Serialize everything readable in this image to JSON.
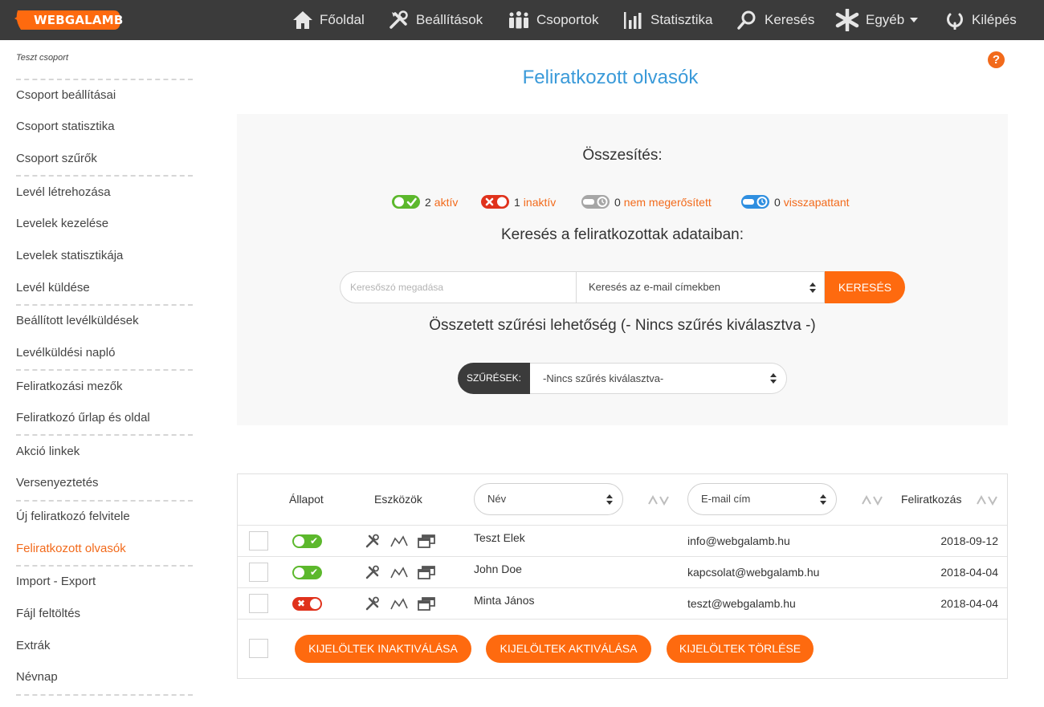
{
  "navbar": {
    "logo": "WEBGALAMB",
    "items": [
      {
        "label": "Főoldal",
        "icon": "home-icon"
      },
      {
        "label": "Beállítások",
        "icon": "tools-icon"
      },
      {
        "label": "Csoportok",
        "icon": "group-icon"
      },
      {
        "label": "Statisztika",
        "icon": "bar-chart-icon"
      },
      {
        "label": "Keresés",
        "icon": "search-icon"
      },
      {
        "label": "Egyéb",
        "icon": "asterisk-icon"
      },
      {
        "label": "Kilépés",
        "icon": "logout-icon"
      }
    ]
  },
  "sidebar": {
    "group": "Teszt csoport",
    "items": [
      "Csoport beállításai",
      "Csoport statisztika",
      "Csoport szűrők",
      "Levél létrehozása",
      "Levelek kezelése",
      "Levelek statisztikája",
      "Levél küldése",
      "Beállított levélküldések",
      "Levélküldési napló",
      "Feliratkozási mezők",
      "Feliratkozó űrlap és oldal",
      "Akció linkek",
      "Versenyeztetés",
      "Új feliratkozó felvitele",
      "Feliratkozott olvasók",
      "Import - Export",
      "Fájl feltöltés",
      "Extrák",
      "Névnap"
    ],
    "active": "Feliratkozott olvasók"
  },
  "main": {
    "help": "?",
    "title": "Feliratkozott olvasók",
    "summary_title": "Összesítés:",
    "stats": [
      {
        "count": "2",
        "label": "aktív",
        "color": "#5cb82c"
      },
      {
        "count": "1",
        "label": "inaktív",
        "color": "#e0321c"
      },
      {
        "count": "0",
        "label": "nem megerősített",
        "color": "#a6a6a6"
      },
      {
        "count": "0",
        "label": "visszapattant",
        "color": "#2f8fe0"
      }
    ],
    "search_title": "Keresés a feliratkozottak adataiban:",
    "search": {
      "placeholder": "Keresőszó megadása",
      "select_value": "Keresés az e-mail címekben",
      "button": "KERESÉS"
    },
    "filter_title": "Összetett szűrési lehetőség (- Nincs szűrés kiválasztva -)",
    "filter": {
      "label": "SZŰRÉSEK:",
      "value": "-Nincs szűrés kiválasztva-"
    }
  },
  "table": {
    "headers": {
      "status": "Állapot",
      "tools": "Eszközök",
      "name": "Név",
      "email": "E-mail cím",
      "subscribed": "Feliratkozás"
    },
    "rows": [
      {
        "active": true,
        "name": "Teszt Elek",
        "email": "info@webgalamb.hu",
        "date": "2018-09-12"
      },
      {
        "active": true,
        "name": "John Doe",
        "email": "kapcsolat@webgalamb.hu",
        "date": "2018-04-04"
      },
      {
        "active": false,
        "name": "Minta János",
        "email": "teszt@webgalamb.hu",
        "date": "2018-04-04"
      }
    ],
    "actions": {
      "deactivate": "KIJELÖLTEK INAKTIVÁLÁSA",
      "activate": "KIJELÖLTEK AKTIVÁLÁSA",
      "delete": "KIJELÖLTEK TÖRLÉSE"
    }
  }
}
